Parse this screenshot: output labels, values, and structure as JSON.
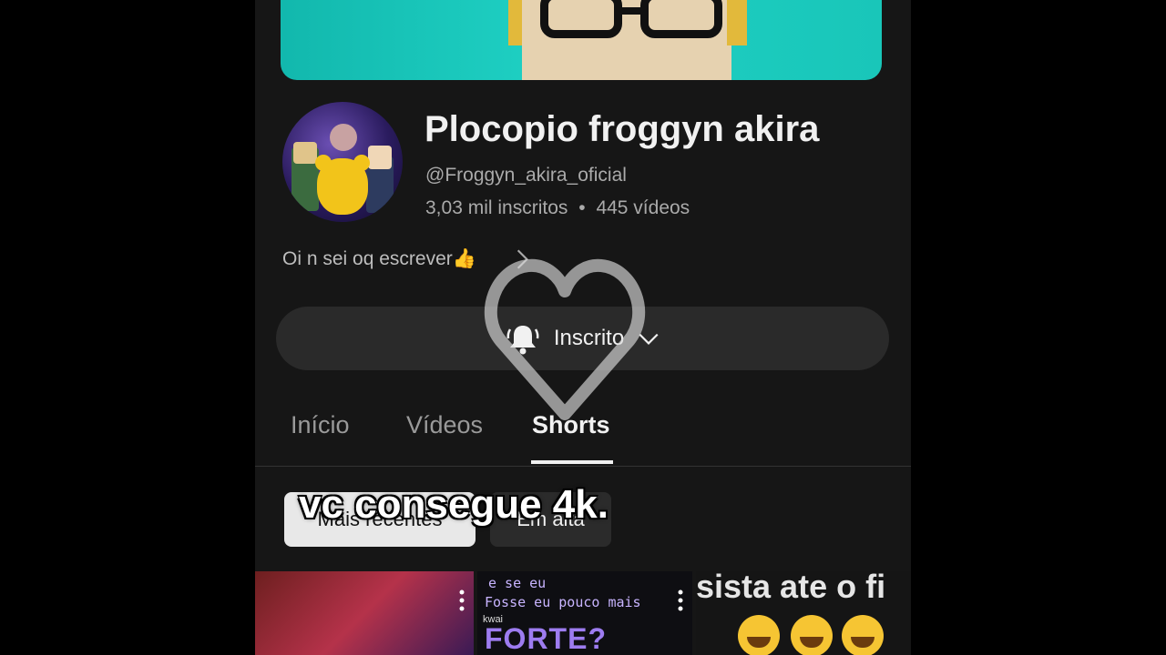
{
  "channel": {
    "name": "Plocopio froggyn akira",
    "handle": "@Froggyn_akira_oficial",
    "subscribers": "3,03 mil inscritos",
    "separator": "•",
    "videos_count": "445 vídeos",
    "description": "Oi n sei oq escrever👍"
  },
  "subscribe": {
    "label": "Inscrito"
  },
  "tabs": [
    {
      "label": "Início"
    },
    {
      "label": "Vídeos"
    },
    {
      "label": "Shorts"
    }
  ],
  "active_tab": "Shorts",
  "chips": [
    {
      "label": "Mais recentes"
    },
    {
      "label": "Em alta"
    }
  ],
  "overlay_caption": "vc consegue 4k.",
  "shorts": [
    {
      "text": ""
    },
    {
      "line1": "e se eu",
      "line2": "Fosse eu pouco mais",
      "brand": "kwai",
      "big": "FORTE?"
    },
    {
      "text": "sista ate o fi"
    }
  ],
  "colors": {
    "background": "#161616",
    "text_primary": "#f1f1f1",
    "text_secondary": "#aaaaaa",
    "button_bg": "#2a2a2a",
    "banner_teal": "#1fd1c4"
  }
}
